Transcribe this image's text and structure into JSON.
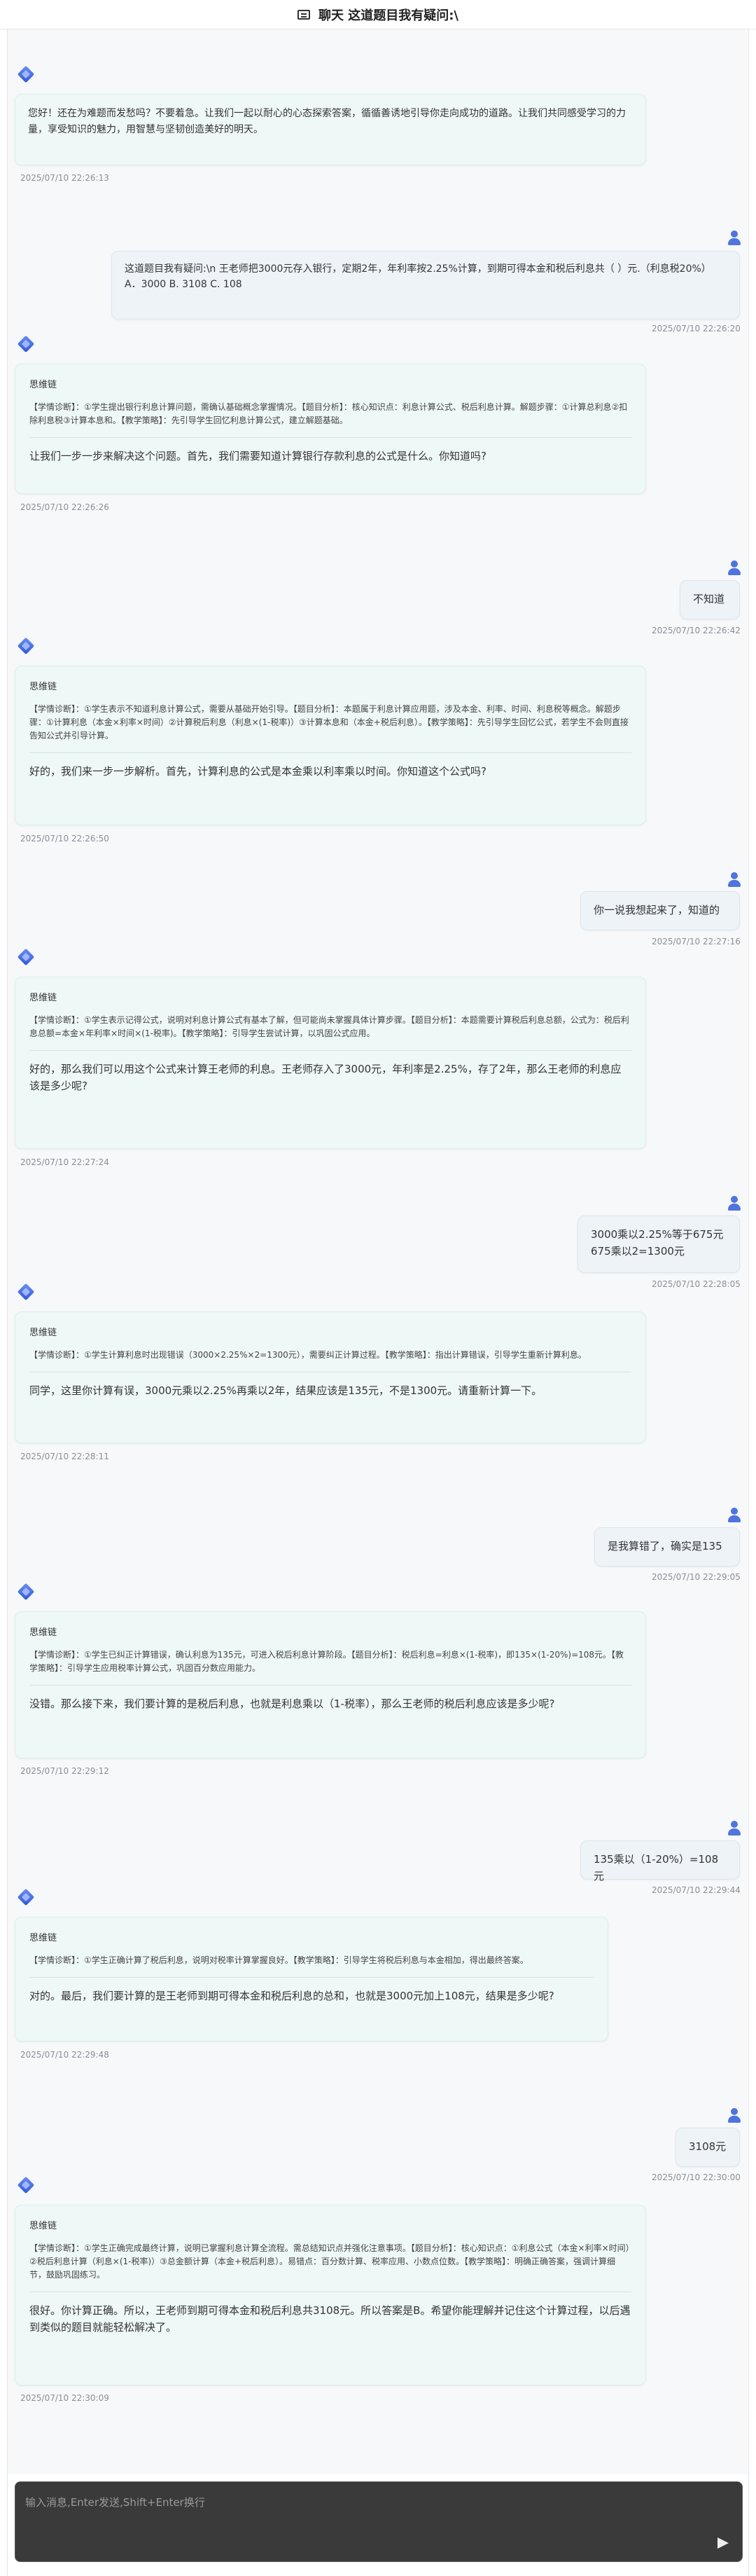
{
  "header": {
    "title": "聊天  这道题目我有疑问:\\",
    "icon": "chat-icon"
  },
  "messages": [
    {
      "role": "ai",
      "reply": "您好！还在为难题而发愁吗？不要着急。让我们一起以耐心的心态探索答案，循循善诱地引导你走向成功的道路。让我们共同感受学习的力量，享受知识的魅力，用智慧与坚韧创造美好的明天。",
      "time": "2025/07/10 22:26:13"
    },
    {
      "role": "user",
      "text": "这道题目我有疑问:\\n 王老师把3000元存入银行，定期2年，年利率按2.25%计算，到期可得本金和税后利息共（     ）元.（利息税20%）\nA．3000 B. 3108 C. 108",
      "time": "2025/07/10 22:26:20"
    },
    {
      "role": "ai",
      "chain_title": "思维链",
      "chain": "【学情诊断】：①学生提出银行利息计算问题，需确认基础概念掌握情况。【题目分析】：核心知识点：利息计算公式、税后利息计算。解题步骤：①计算总利息②扣除利息税③计算本息和。【教学策略】：先引导学生回忆利息计算公式，建立解题基础。",
      "reply": "让我们一步一步来解决这个问题。首先，我们需要知道计算银行存款利息的公式是什么。你知道吗?",
      "time": "2025/07/10 22:26:26"
    },
    {
      "role": "user",
      "text": "不知道",
      "time": "2025/07/10 22:26:42"
    },
    {
      "role": "ai",
      "chain_title": "思维链",
      "chain": "【学情诊断】：①学生表示不知道利息计算公式，需要从基础开始引导。【题目分析】：本题属于利息计算应用题，涉及本金、利率、时间、利息税等概念。解题步骤：①计算利息（本金×利率×时间）②计算税后利息（利息×(1-税率)）③计算本息和（本金+税后利息）。【教学策略】：先引导学生回忆公式，若学生不会则直接告知公式并引导计算。",
      "reply": "好的，我们来一步一步解析。首先，计算利息的公式是本金乘以利率乘以时间。你知道这个公式吗?",
      "time": "2025/07/10 22:26:50"
    },
    {
      "role": "user",
      "text": "你一说我想起来了，知道的",
      "time": "2025/07/10 22:27:16"
    },
    {
      "role": "ai",
      "chain_title": "思维链",
      "chain": "【学情诊断】：①学生表示记得公式，说明对利息计算公式有基本了解，但可能尚未掌握具体计算步骤。【题目分析】：本题需要计算税后利息总额，公式为：税后利息总额=本金×年利率×时间×(1-税率)。【教学策略】：引导学生尝试计算，以巩固公式应用。",
      "reply": "好的，那么我们可以用这个公式来计算王老师的利息。王老师存入了3000元，年利率是2.25%，存了2年，那么王老师的利息应该是多少呢?",
      "time": "2025/07/10 22:27:24"
    },
    {
      "role": "user",
      "text": "3000乘以2.25%等于675元\n675乘以2=1300元",
      "time": "2025/07/10 22:28:05"
    },
    {
      "role": "ai",
      "chain_title": "思维链",
      "chain": "【学情诊断】：①学生计算利息时出现错误（3000×2.25%×2=1300元），需要纠正计算过程。【教学策略】：指出计算错误，引导学生重新计算利息。",
      "reply": "同学，这里你计算有误，3000元乘以2.25%再乘以2年，结果应该是135元，不是1300元。请重新计算一下。",
      "time": "2025/07/10 22:28:11"
    },
    {
      "role": "user",
      "text": "是我算错了，确实是135",
      "time": "2025/07/10 22:29:05"
    },
    {
      "role": "ai",
      "chain_title": "思维链",
      "chain": "【学情诊断】：①学生已纠正计算错误，确认利息为135元，可进入税后利息计算阶段。【题目分析】：税后利息=利息×(1-税率)，即135×(1-20%)=108元。【教学策略】：引导学生应用税率计算公式，巩固百分数应用能力。",
      "reply": "没错。那么接下来，我们要计算的是税后利息，也就是利息乘以（1-税率），那么王老师的税后利息应该是多少呢?",
      "time": "2025/07/10 22:29:12"
    },
    {
      "role": "user",
      "text": "135乘以（1-20%）=108元",
      "time": "2025/07/10 22:29:44"
    },
    {
      "role": "ai",
      "chain_title": "思维链",
      "chain": "【学情诊断】：①学生正确计算了税后利息，说明对税率计算掌握良好。【教学策略】：引导学生将税后利息与本金相加，得出最终答案。",
      "reply": "对的。最后，我们要计算的是王老师到期可得本金和税后利息的总和，也就是3000元加上108元，结果是多少呢?",
      "time": "2025/07/10 22:29:48"
    },
    {
      "role": "user",
      "text": "3108元",
      "time": "2025/07/10 22:30:00"
    },
    {
      "role": "ai",
      "chain_title": "思维链",
      "chain": "【学情诊断】：①学生正确完成最终计算，说明已掌握利息计算全流程。需总结知识点并强化注意事项。【题目分析】：核心知识点：①利息公式（本金×利率×时间）②税后利息计算（利息×(1-税率)）③总金额计算（本金+税后利息）。易错点：百分数计算、税率应用、小数点位数。【教学策略】：明确正确答案，强调计算细节，鼓励巩固练习。",
      "reply": "很好。你计算正确。所以，王老师到期可得本金和税后利息共3108元。所以答案是B。希望你能理解并记住这个计算过程，以后遇到类似的题目就能轻松解决了。",
      "time": "2025/07/10 22:30:09"
    }
  ],
  "input": {
    "placeholder": "输入消息,Enter发送,Shift+Enter换行",
    "send_icon": "send-icon"
  }
}
